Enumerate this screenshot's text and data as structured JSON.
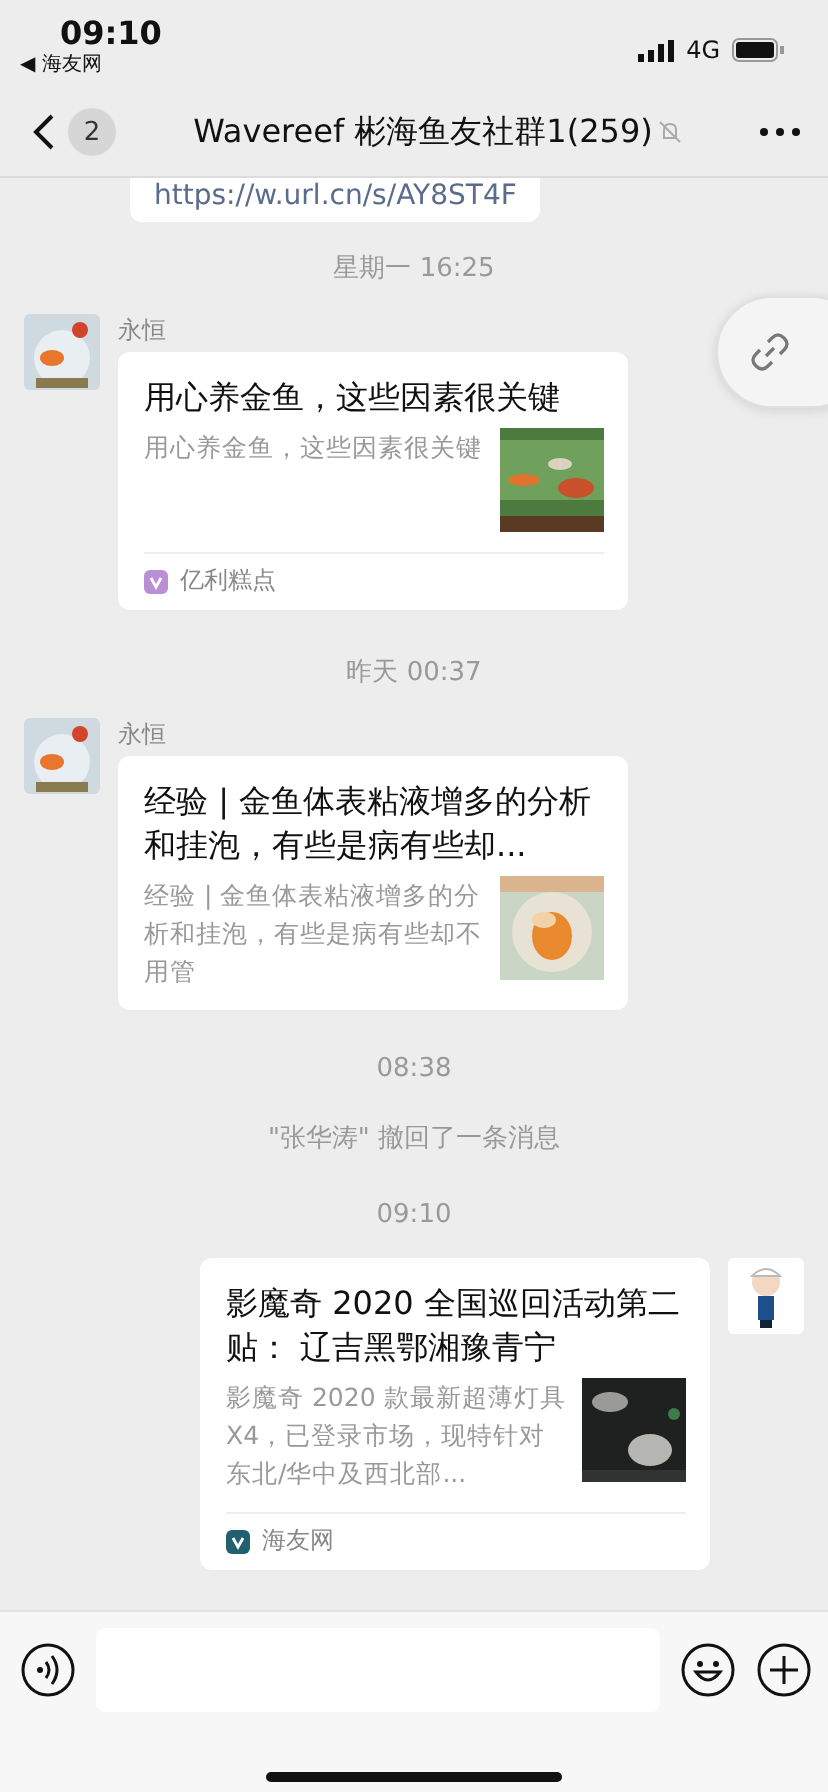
{
  "status_bar": {
    "time": "09:10",
    "back_app": "◀ 海友网",
    "network": "4G"
  },
  "nav": {
    "back_count": "2",
    "title": "Wavereef 彬海鱼友社群1(259)",
    "muted": true
  },
  "messages": [
    {
      "kind": "partial",
      "text": "https://w.url.cn/s/AY8ST4F"
    },
    {
      "kind": "time",
      "text": "星期一 16:25"
    },
    {
      "kind": "article",
      "outgoing": false,
      "sender": "永恒",
      "title": "用心养金鱼，这些因素很关键",
      "desc": "用心养金鱼，这些因素很关键",
      "source": {
        "name": "亿利糕点",
        "color": "#b98fd6"
      }
    },
    {
      "kind": "time",
      "text": "昨天 00:37"
    },
    {
      "kind": "article",
      "outgoing": false,
      "sender": "永恒",
      "title": "经验 | 金鱼体表粘液增多的分析和挂泡，有些是病有些却...",
      "desc": "经验 | 金鱼体表粘液增多的分析和挂泡，有些是病有些却不用管"
    },
    {
      "kind": "time",
      "text": "08:38"
    },
    {
      "kind": "system",
      "text": "\"张华涛\" 撤回了一条消息"
    },
    {
      "kind": "time",
      "text": "09:10"
    },
    {
      "kind": "article",
      "outgoing": true,
      "title": "影魔奇 2020 全国巡回活动第二贴：  辽吉黑鄂湘豫青宁",
      "desc": "影魔奇 2020 款最新超薄灯具 X4，已登录市场，现特针对东北/华中及西北部...",
      "source": {
        "name": "海友网",
        "color": "#21606e"
      }
    }
  ]
}
